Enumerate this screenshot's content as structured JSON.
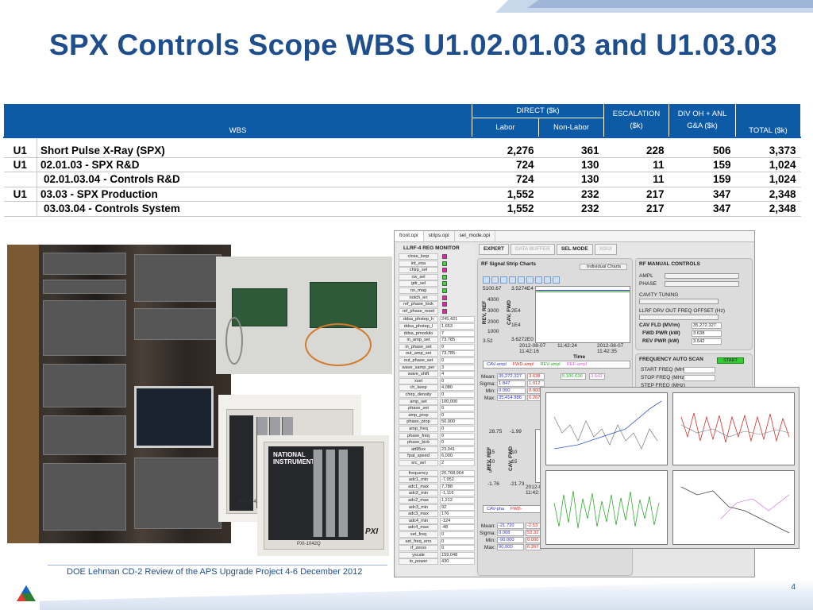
{
  "slide": {
    "title": "SPX Controls Scope  WBS U1.02.01.03 and U1.03.03",
    "footer": "DOE Lehman CD-2 Review of the APS Upgrade Project   4-6 December  2012",
    "page_number": "4",
    "accent_color": "#1f4e8c",
    "header_color": "#0d5aa6"
  },
  "table": {
    "headers": {
      "wbs": "WBS",
      "direct": "DIRECT ($k)",
      "labor": "Labor",
      "non_labor": "Non-Labor",
      "escalation_1": "ESCALATION",
      "escalation_2": "($k)",
      "div_oh_1": "DIV OH + ANL",
      "div_oh_2": "G&A ($k)",
      "total": "TOTAL ($k)"
    },
    "rows": [
      {
        "code": "U1",
        "name": "Short Pulse X-Ray (SPX)",
        "labor": "2,276",
        "non_labor": "361",
        "escalation": "228",
        "div_oh": "506",
        "total": "3,373"
      },
      {
        "code": "U1",
        "name": "02.01.03 - SPX R&D",
        "labor": "724",
        "non_labor": "130",
        "escalation": "11",
        "div_oh": "159",
        "total": "1,024"
      },
      {
        "code": "",
        "name": "02.01.03.04 - Controls R&D",
        "labor": "724",
        "non_labor": "130",
        "escalation": "11",
        "div_oh": "159",
        "total": "1,024"
      },
      {
        "code": "U1",
        "name": "03.03 - SPX Production",
        "labor": "1,552",
        "non_labor": "232",
        "escalation": "217",
        "div_oh": "347",
        "total": "2,348"
      },
      {
        "code": "",
        "name": "03.03.04 - Controls System",
        "labor": "1,552",
        "non_labor": "232",
        "escalation": "217",
        "div_oh": "347",
        "total": "2,348"
      }
    ]
  },
  "photos": {
    "chassis_brand": "NATIONAL INSTRUMENTS",
    "chassis_label": "PXI",
    "chassis_model": "PXI-1042Q"
  },
  "scope": {
    "tabs": [
      "front.opi",
      "strips.opi",
      "sel_mode.opi"
    ],
    "top_buttons": [
      "EXPERT",
      "DATA BUFFER",
      "SEL MODE",
      "XGUI"
    ],
    "monitor_title": "LLRF-4 REG MONITOR",
    "led_signals": [
      {
        "name": "close_loop",
        "color": "#ee22aa"
      },
      {
        "name": "int_ena",
        "color": "#33dd33"
      },
      {
        "name": "chirp_sel",
        "color": "#ee22aa"
      },
      {
        "name": "cw_sel",
        "color": "#33dd33"
      },
      {
        "name": "gdr_sel",
        "color": "#33dd33"
      },
      {
        "name": "no_mag",
        "color": "#33dd33"
      },
      {
        "name": "notch_en",
        "color": "#ee22aa"
      },
      {
        "name": "ref_phase_lock",
        "color": "#ee22aa"
      },
      {
        "name": "ref_phase_reset",
        "color": "#ee22aa"
      }
    ],
    "value_signals": [
      {
        "name": "ddsa_phstep_h",
        "value": "245,421"
      },
      {
        "name": "ddsa_phstep_l",
        "value": "1,653"
      },
      {
        "name": "ddsa_pmodulo",
        "value": "7"
      },
      {
        "name": "in_amp_set",
        "value": "73,785"
      },
      {
        "name": "in_phase_set",
        "value": "0"
      },
      {
        "name": "out_amp_set",
        "value": "73,785"
      },
      {
        "name": "out_phase_set",
        "value": "0"
      },
      {
        "name": "wave_samp_per",
        "value": "3"
      },
      {
        "name": "wave_shift",
        "value": "4"
      },
      {
        "name": "xsel",
        "value": "0"
      },
      {
        "name": "ch_keep",
        "value": "4,080"
      },
      {
        "name": "chirp_density",
        "value": "0"
      },
      {
        "name": "amp_set",
        "value": "100,000"
      },
      {
        "name": "phase_set",
        "value": "0"
      },
      {
        "name": "amp_prop",
        "value": "0"
      },
      {
        "name": "phase_prop",
        "value": "50,000"
      },
      {
        "name": "amp_freq",
        "value": "0"
      },
      {
        "name": "phase_freq",
        "value": "0"
      },
      {
        "name": "phase_kick",
        "value": "0"
      },
      {
        "name": "att95xx",
        "value": "23,041"
      },
      {
        "name": "fpat_speed",
        "value": "6,000"
      },
      {
        "name": "src_sel",
        "value": "2"
      },
      {
        "name": "frequency",
        "value": "26,768,964"
      },
      {
        "name": "adc1_min",
        "value": "-7,952"
      },
      {
        "name": "adc1_max",
        "value": "7,788"
      },
      {
        "name": "adc2_min",
        "value": "-1,116"
      },
      {
        "name": "adc2_max",
        "value": "1,212"
      },
      {
        "name": "adc3_min",
        "value": "92"
      },
      {
        "name": "adc3_max",
        "value": "176"
      },
      {
        "name": "adc4_min",
        "value": "-124"
      },
      {
        "name": "adc4_max",
        "value": "-48"
      },
      {
        "name": "set_freq",
        "value": "0"
      },
      {
        "name": "set_freq_errs",
        "value": "0"
      },
      {
        "name": "rf_zeros",
        "value": "0"
      },
      {
        "name": "yscale",
        "value": "159,048"
      },
      {
        "name": "lo_power",
        "value": "430"
      }
    ],
    "strip_title": "RF Signal Strip Charts",
    "individual_charts": "Individual Charts",
    "strip1": {
      "y_top": "5100.67",
      "y_2": "3.5274E4",
      "y_3": "4000",
      "y_4": "3000",
      "y_5": "2000",
      "y_6": "2E4",
      "y_7": "1000",
      "y_8": "1E4",
      "y_9": "3.52",
      "y_10": "3.6272E0",
      "axis_left": "REV, REF",
      "axis_right": "CAV, FWD",
      "t_start": "2012-08-07\n11:42:16",
      "t_mid": "11:42:24",
      "t_end": "2012-08-07\n11:42:35",
      "time_label": "Time",
      "legend": [
        "CAV-ampl",
        "FWD-ampl",
        "REV-ampl",
        "REF-ampl"
      ],
      "legend_colors": [
        "#3333cc",
        "#dd2222",
        "#22aa22",
        "#cc66cc"
      ],
      "stats_labels": [
        "Mean:",
        "Sigma:",
        "Min:",
        "Max:"
      ],
      "stats_cav": [
        "35,272.327",
        "1.847",
        "0.000",
        "35,414.886"
      ],
      "stats_fwd": [
        "3.638",
        "1.912",
        "0.000",
        "6.267"
      ],
      "stats_rev": [
        "5,100.636"
      ],
      "stats_ref": [
        "3.542"
      ]
    },
    "strip2": {
      "y_top": "28.75",
      "y_top2": "-1.99",
      "y_a": "15",
      "y_b": "10",
      "y_c": "5",
      "y_d": "-10",
      "y_e": "-15",
      "y_bottom": "-1.76",
      "y_bottom2": "-21.73",
      "axis_left": "REV, REF",
      "axis_right": "CAV, FWD",
      "t_start": "2012-08-07\n11:42:16",
      "legend": [
        "CAV-pha",
        "FWD-"
      ],
      "stats_labels": [
        "Mean:",
        "Sigma:",
        "Min:",
        "Max:"
      ],
      "stats_cav": [
        "-21.720",
        "0.008",
        "-90.000",
        "90.000"
      ],
      "stats_fwd": [
        "-2.53",
        "53.32",
        "0.000",
        "6.267"
      ]
    },
    "manual_controls": {
      "title": "RF MANUAL CONTROLS",
      "ampl": "AMPL",
      "phase": "PHASE",
      "cavity_tuning": "CAVITY TUNING",
      "llrf_offset": "LLRF DRV OUT FREQ OFFSET  (Hz)",
      "readouts": [
        {
          "label": "CAV FLD (MV/m)",
          "value": "35,272.327"
        },
        {
          "label": "FWD PWR (kW)",
          "value": "3.638"
        },
        {
          "label": "REV PWR (kW)",
          "value": "3.542"
        }
      ]
    },
    "auto_scan": {
      "title": "FREQUENCY AUTO SCAN",
      "start_button": "START",
      "start_freq": "START  FREQ (MHz)",
      "stop_freq": "STOP  FREQ (MHz)",
      "step_freq": "STEP FREQ (MHz)"
    }
  }
}
